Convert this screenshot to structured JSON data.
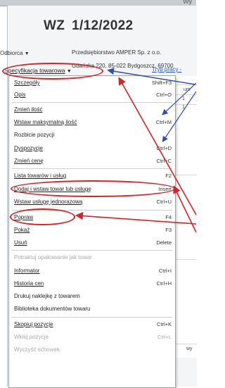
{
  "window": {
    "title_fragment": "Wy"
  },
  "document": {
    "type": "WZ",
    "number": "1/12/2022"
  },
  "recipient": {
    "label": "Odbiorca",
    "caret": "▼",
    "name": "Przedsiębiorstwo AMPER Sp. z o.o.",
    "address": "Gdańska 220, 85-022 Bydgoszcz, 69700"
  },
  "spec": {
    "label": "Specyfikacja towarowa",
    "caret": "▼"
  },
  "mode": {
    "label": "Tryb pracy -"
  },
  "grid": {
    "frag1": "um",
    "frag2": "1",
    "frag3": "1",
    "frag4": "wy"
  },
  "menu": {
    "items": [
      {
        "label": "Szczegóły",
        "shortcut": "Shift+F3",
        "disabled": false
      },
      {
        "label": "Opis",
        "shortcut": "Ctrl+O",
        "disabled": false
      },
      {
        "label": "Zmień ilość",
        "shortcut": "",
        "disabled": false
      },
      {
        "label": "Wstaw maksymalną ilość",
        "shortcut": "Ctrl+M",
        "disabled": false
      },
      {
        "label": "Rozbicie pozycji",
        "shortcut": "",
        "disabled": false
      },
      {
        "label": "Dyspozycje",
        "shortcut": "Ctrl+D",
        "disabled": false
      },
      {
        "label": "Zmień cenę",
        "shortcut": "Ctrl+C",
        "disabled": false
      },
      {
        "label": "Lista towarów i usług",
        "shortcut": "F2",
        "disabled": false
      },
      {
        "label": "Dodaj i wstaw towar lub usługę",
        "shortcut": "Insert",
        "disabled": false
      },
      {
        "label": "Wstaw usługę jednorazową",
        "shortcut": "Ctrl+U",
        "disabled": false
      },
      {
        "label": "Popraw",
        "shortcut": "F4",
        "disabled": false
      },
      {
        "label": "Pokaż",
        "shortcut": "F3",
        "disabled": false
      },
      {
        "label": "Usuń",
        "shortcut": "Delete",
        "disabled": false
      },
      {
        "label": "Potraktuj opakowanie jak towar",
        "shortcut": "",
        "disabled": true
      },
      {
        "label": "Informator",
        "shortcut": "Ctrl+I",
        "disabled": false
      },
      {
        "label": "Historia cen",
        "shortcut": "Ctrl+H",
        "disabled": false
      },
      {
        "label": "Drukuj naklejkę z towarem",
        "shortcut": "",
        "disabled": false
      },
      {
        "label": "Biblioteka dokumentów towaru",
        "shortcut": "",
        "disabled": false
      },
      {
        "label": "Skopiuj pozycje",
        "shortcut": "Ctrl+K",
        "disabled": false
      },
      {
        "label": "Wklej pozycje",
        "shortcut": "Ctrl+L",
        "disabled": true
      },
      {
        "label": "Wyczyść schowek",
        "shortcut": "",
        "disabled": true
      }
    ]
  },
  "annotation_color": "#d8222a",
  "pointer_color": "#2a4fb8"
}
